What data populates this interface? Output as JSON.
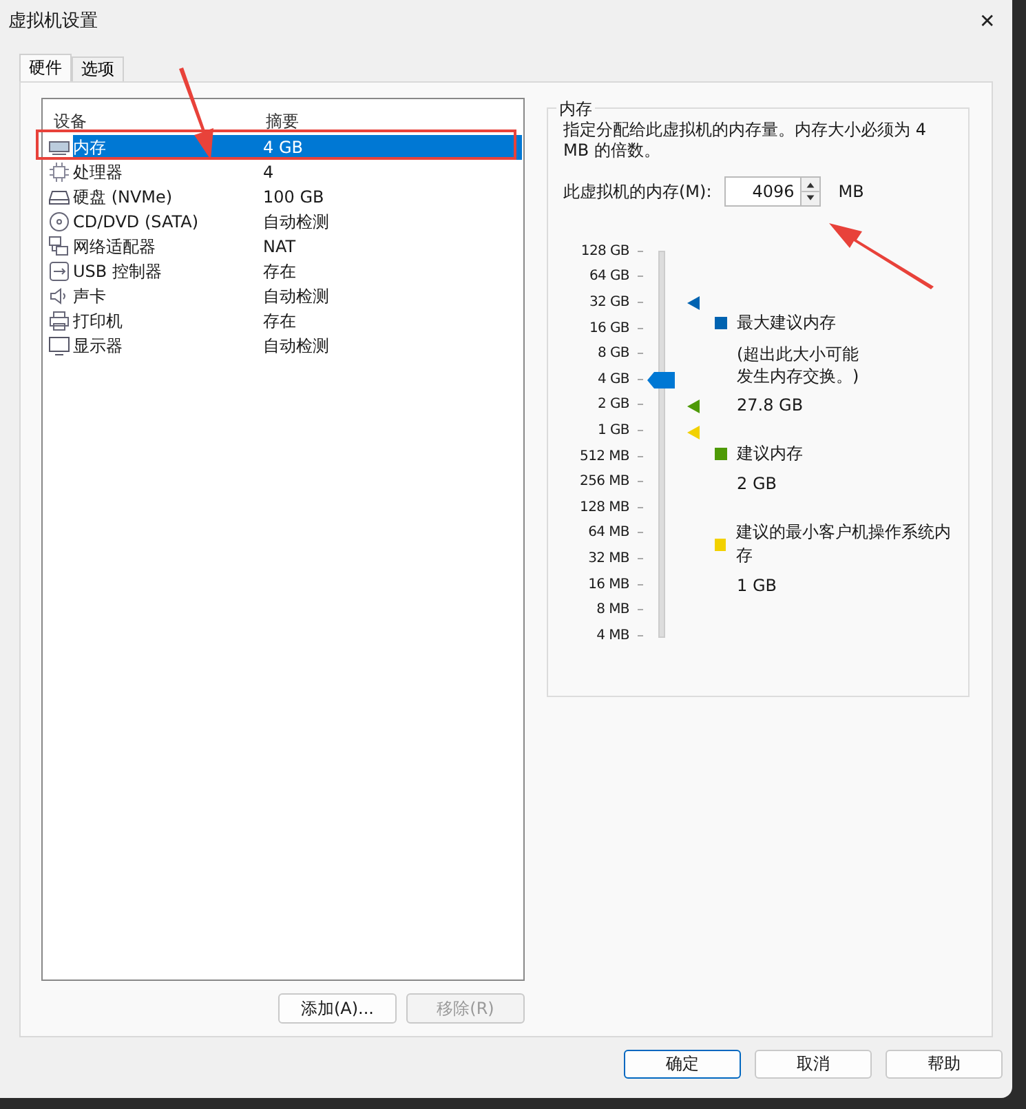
{
  "window": {
    "title": "虚拟机设置",
    "close": "✕"
  },
  "tabs": [
    {
      "label": "硬件",
      "selected": true
    },
    {
      "label": "选项",
      "selected": false
    }
  ],
  "devices": {
    "columns": [
      "设备",
      "摘要"
    ],
    "rows": [
      {
        "kind": "memory",
        "name": "内存",
        "summary": "4 GB",
        "selected": true
      },
      {
        "kind": "cpu",
        "name": "处理器",
        "summary": "4",
        "selected": false
      },
      {
        "kind": "disk",
        "name": "硬盘 (NVMe)",
        "summary": "100 GB",
        "selected": false
      },
      {
        "kind": "cd",
        "name": "CD/DVD (SATA)",
        "summary": "自动检测",
        "selected": false
      },
      {
        "kind": "network",
        "name": "网络适配器",
        "summary": "NAT",
        "selected": false
      },
      {
        "kind": "usb",
        "name": "USB 控制器",
        "summary": "存在",
        "selected": false
      },
      {
        "kind": "sound",
        "name": "声卡",
        "summary": "自动检测",
        "selected": false
      },
      {
        "kind": "printer",
        "name": "打印机",
        "summary": "存在",
        "selected": false
      },
      {
        "kind": "display",
        "name": "显示器",
        "summary": "自动检测",
        "selected": false
      }
    ]
  },
  "list_buttons": [
    {
      "label": "添加(A)...",
      "disabled": false
    },
    {
      "label": "移除(R)",
      "disabled": true
    }
  ],
  "memory": {
    "title": "内存",
    "description": "指定分配给此虚拟机的内存量。内存大小必须为 4 MB 的倍数。",
    "field_label": "此虚拟机的内存(M):",
    "value": "4096",
    "unit": "MB",
    "scale": [
      "128 GB",
      "64 GB",
      "32 GB",
      "16 GB",
      "8 GB",
      "4 GB",
      "2 GB",
      "1 GB",
      "512 MB",
      "256 MB",
      "128 MB",
      "64 MB",
      "32 MB",
      "16 MB",
      "8 MB",
      "4 MB"
    ],
    "level": 0.667,
    "markers": [
      {
        "color": "#0063b1",
        "level": 0.867
      },
      {
        "color": "#4e9a06",
        "level": 0.6
      },
      {
        "color": "#f2d100",
        "level": 0.533
      }
    ],
    "legend": [
      {
        "color": "#0063b1",
        "title": "最大建议内存",
        "note": "(超出此大小可能发生内存交换。)",
        "value": "27.8 GB"
      },
      {
        "color": "#4e9a06",
        "title": "建议内存",
        "value": "2 GB"
      },
      {
        "color": "#f2d100",
        "title": "建议的最小客户机操作系统内存",
        "value": "1 GB"
      }
    ]
  },
  "buttons": [
    {
      "label": "确定",
      "default": true
    },
    {
      "label": "取消",
      "default": false
    },
    {
      "label": "帮助",
      "default": false
    }
  ]
}
